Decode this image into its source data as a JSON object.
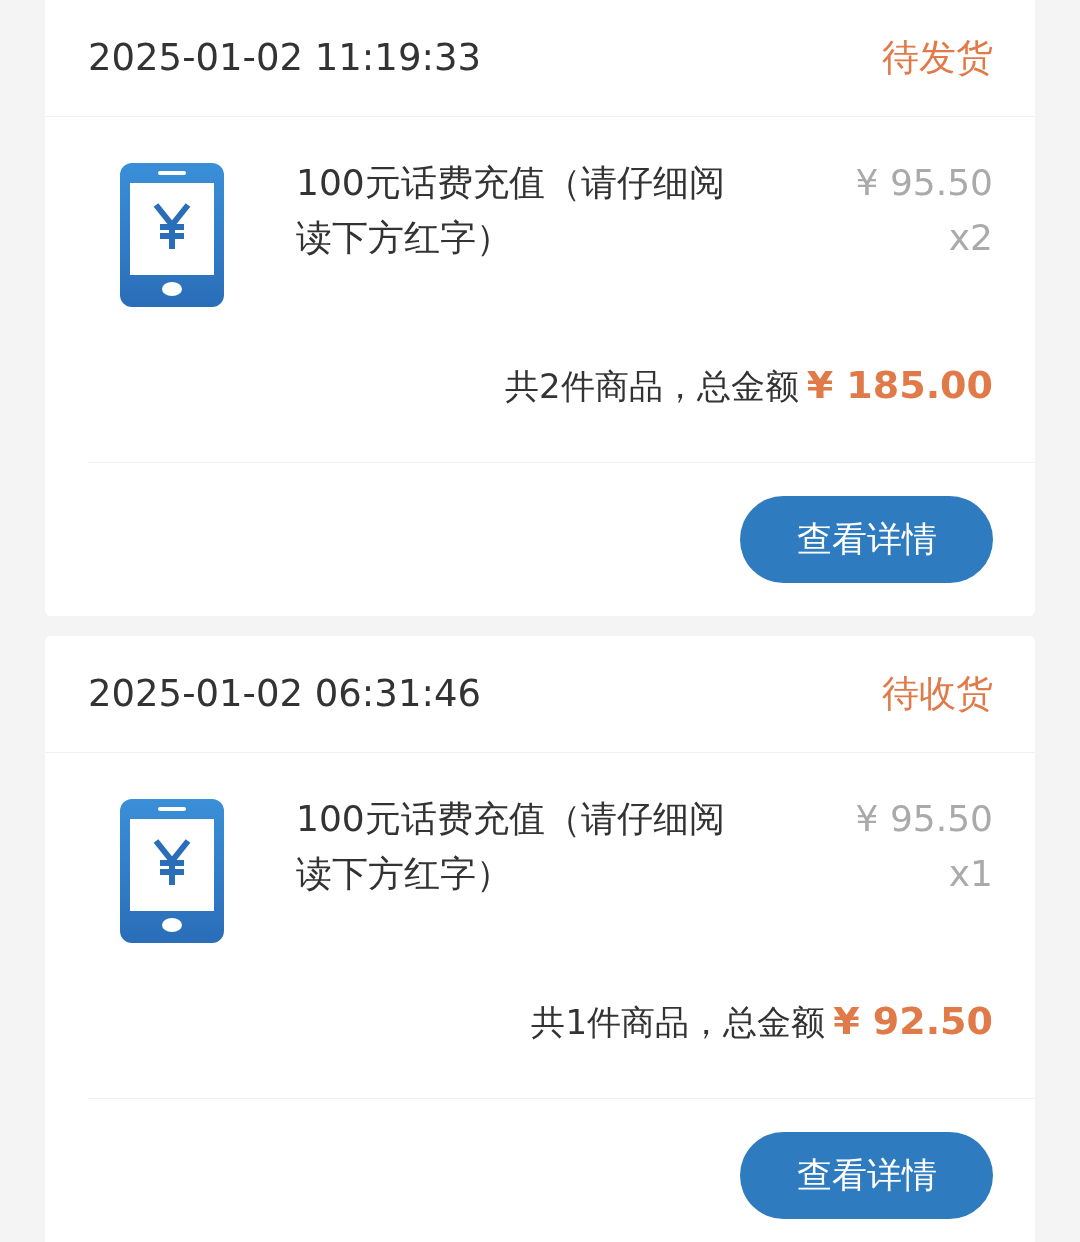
{
  "orders": [
    {
      "time": "2025-01-02 11:19:33",
      "status": "待发货",
      "items": [
        {
          "title": "100元话费充值（请仔细阅读下方红字）",
          "price": "¥ 95.50",
          "qty": "x2"
        }
      ],
      "summary": "共2件商品，总金额",
      "total": "¥ 185.00",
      "button": "查看详情"
    },
    {
      "time": "2025-01-02 06:31:46",
      "status": "待收货",
      "items": [
        {
          "title": "100元话费充值（请仔细阅读下方红字）",
          "price": "¥ 95.50",
          "qty": "x1"
        }
      ],
      "summary": "共1件商品，总金额",
      "total": "¥ 92.50",
      "button": "查看详情"
    }
  ]
}
